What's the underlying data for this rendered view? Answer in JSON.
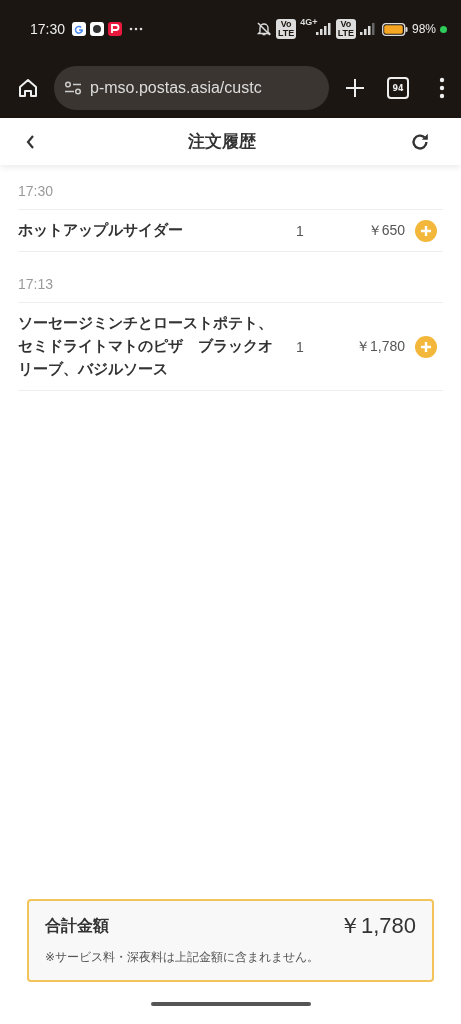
{
  "status_bar": {
    "time": "17:30",
    "volte": [
      [
        "Vo",
        "LTE"
      ],
      [
        "Vo",
        "LTE"
      ]
    ],
    "network": "4G+",
    "battery": "98%"
  },
  "browser": {
    "url": "p-mso.postas.asia/custc",
    "tab_count": "94"
  },
  "header": {
    "title": "注文履歴"
  },
  "orders": [
    {
      "time": "17:30",
      "items": [
        {
          "name": "ホットアップルサイダー",
          "quantity": "1",
          "price": "￥650"
        }
      ]
    },
    {
      "time": "17:13",
      "items": [
        {
          "name": "ソーセージミンチとローストポテト、セミドライトマトのピザ　ブラックオリーブ、バジルソース",
          "quantity": "1",
          "price": "￥1,780"
        }
      ]
    }
  ],
  "total": {
    "label": "合計金額",
    "amount": "￥1,780",
    "note": "※サービス料・深夜料は上記金額に含まれません。"
  }
}
